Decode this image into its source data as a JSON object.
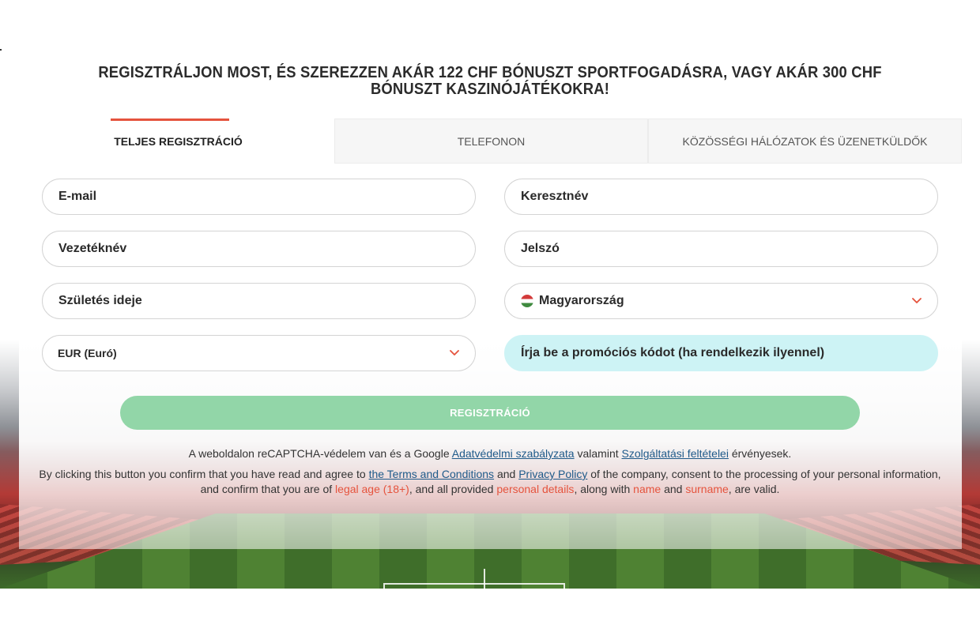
{
  "headline": "REGISZTRÁLJON MOST, ÉS SZEREZZEN AKÁR 122 CHF BÓNUSZT SPORTFOGADÁSRA, VAGY AKÁR 300 CHF BÓNUSZT KASZINÓJÁTÉKOKRA!",
  "tabs": [
    {
      "label": "TELJES REGISZTRÁCIÓ",
      "active": true
    },
    {
      "label": "TELEFONON",
      "active": false
    },
    {
      "label": "KÖZÖSSÉGI HÁLÓZATOK ÉS ÜZENETKÜLDŐK",
      "active": false
    }
  ],
  "fields": {
    "email": "E-mail",
    "first_name": "Keresztnév",
    "last_name": "Vezetéknév",
    "password": "Jelszó",
    "birth_date": "Születés ideje",
    "country": "Magyarország",
    "currency": "EUR (Euró)",
    "promo_code": "Írja be a promóciós kódot (ha rendelkezik ilyennel)"
  },
  "submit_label": "REGISZTRÁCIÓ",
  "recaptcha": {
    "text_1": "A weboldalon reCAPTCHA-védelem van és a Google ",
    "privacy_link": "Adatvédelmi szabályzata",
    "text_2": " valamint ",
    "terms_link": "Szolgáltatási feltételei",
    "text_3": " érvényesek."
  },
  "terms": {
    "text_1": "By clicking this button you confirm that you have read and agree to ",
    "terms_link": "the Terms and Conditions",
    "text_2": " and ",
    "privacy_link": "Privacy Policy",
    "text_3": " of the company, consent to the processing of your personal information, and confirm that you are of ",
    "legal_age": "legal age (18+)",
    "text_4": ", and all provided ",
    "personal_details": "personal details",
    "text_5": ", along with ",
    "name": "name",
    "text_6": " and ",
    "surname": "surname",
    "text_7": ", are valid."
  },
  "colors": {
    "accent": "#e5533d",
    "submit_bg": "#92d6a8",
    "promo_bg": "#cdf3f5",
    "link": "#1f5a8a"
  },
  "icons": {
    "dropdown": "chevron-down-icon",
    "country_flag": "hungary-flag-icon"
  }
}
